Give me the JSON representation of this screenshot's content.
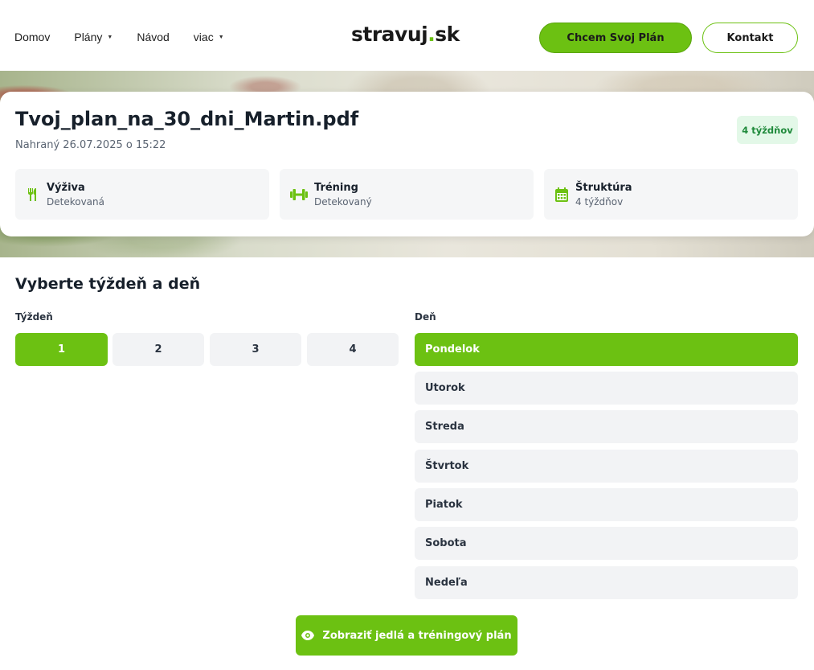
{
  "header": {
    "nav": [
      {
        "label": "Domov",
        "dropdown": false
      },
      {
        "label": "Plány",
        "dropdown": true
      },
      {
        "label": "Návod",
        "dropdown": false
      },
      {
        "label": "viac",
        "dropdown": true
      }
    ],
    "logo_left": "stravuj",
    "logo_dot": ".",
    "logo_right": "sk",
    "cta_label": "Chcem Svoj Plán",
    "contact_label": "Kontakt"
  },
  "file": {
    "name": "Tvoj_plan_na_30_dni_Martin.pdf",
    "uploaded": "Nahraný 26.07.2025 o 15:22",
    "badge": "4 týždňov",
    "info": [
      {
        "title": "Výživa",
        "sub": "Detekovaná",
        "icon": "fork-knife-icon"
      },
      {
        "title": "Tréning",
        "sub": "Detekovaný",
        "icon": "dumbbell-icon"
      },
      {
        "title": "Štruktúra",
        "sub": "4 týždňov",
        "icon": "calendar-icon"
      }
    ]
  },
  "selector": {
    "title": "Vyberte týždeň a deň",
    "week_label": "Týždeň",
    "day_label": "Deň",
    "weeks": [
      "1",
      "2",
      "3",
      "4"
    ],
    "selected_week": "1",
    "days": [
      "Pondelok",
      "Utorok",
      "Streda",
      "Štvrtok",
      "Piatok",
      "Sobota",
      "Nedeľa"
    ],
    "selected_day": "Pondelok",
    "show_label": "Zobraziť jedlá a tréningový plán"
  },
  "colors": {
    "accent": "#6cc112",
    "badge_bg": "#e3f8e8",
    "badge_text": "#1f8a3b",
    "button_bg": "#f2f3f5"
  }
}
